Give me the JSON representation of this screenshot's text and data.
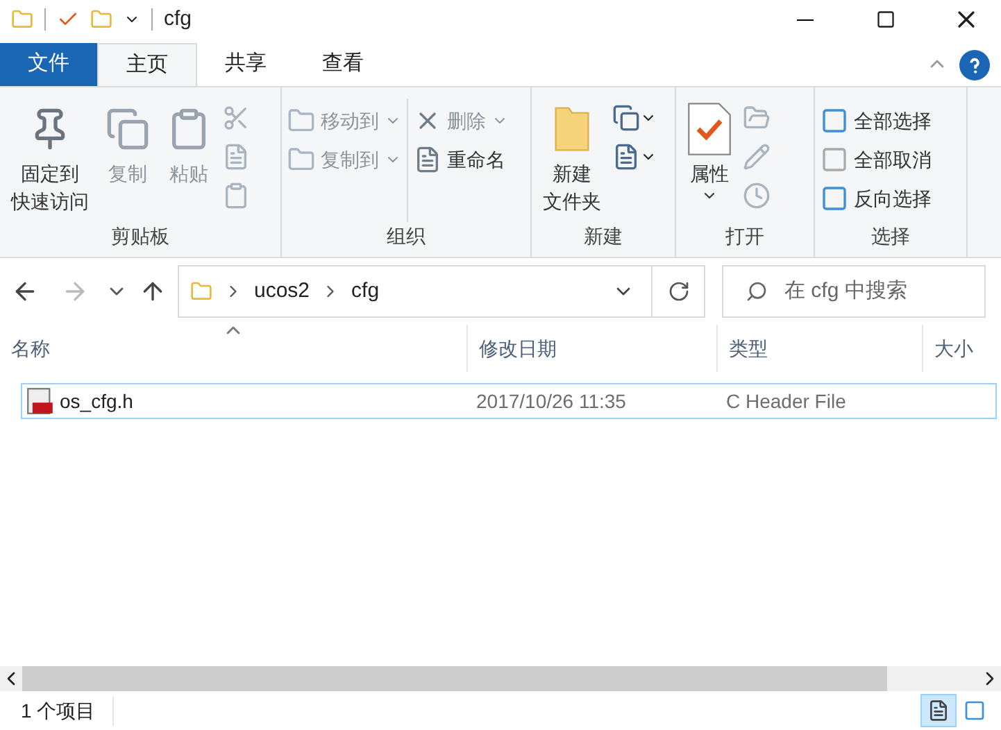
{
  "title_bar": {
    "title": "cfg"
  },
  "ribbon_tabs": [
    {
      "label": "文件",
      "kind": "file",
      "selected": false
    },
    {
      "label": "主页",
      "kind": "tab",
      "selected": true
    },
    {
      "label": "共享",
      "kind": "tab",
      "selected": false
    },
    {
      "label": "查看",
      "kind": "tab",
      "selected": false
    }
  ],
  "ribbon_groups": [
    {
      "label": "剪贴板",
      "items": [
        {
          "kind": "large",
          "lines": [
            "固定到",
            "快速访问"
          ],
          "disabled": false
        },
        {
          "kind": "large",
          "lines": [
            "复制"
          ],
          "disabled": true
        },
        {
          "kind": "large",
          "lines": [
            "粘贴"
          ],
          "disabled": true
        },
        {
          "kind": "iconstack",
          "disabled": true
        }
      ]
    },
    {
      "label": "组织",
      "items": [
        {
          "kind": "smallcol",
          "entries": [
            {
              "label": "移动到",
              "dropdown": true,
              "disabled": true
            },
            {
              "label": "复制到",
              "dropdown": true,
              "disabled": true
            }
          ]
        },
        {
          "kind": "smallcol",
          "entries": [
            {
              "label": "删除",
              "dropdown": true,
              "disabled": true
            },
            {
              "label": "重命名",
              "dropdown": false,
              "disabled": false
            }
          ]
        }
      ]
    },
    {
      "label": "新建",
      "items": [
        {
          "kind": "large",
          "lines": [
            "新建",
            "文件夹"
          ],
          "disabled": false
        },
        {
          "kind": "iconstack",
          "disabled": false
        }
      ]
    },
    {
      "label": "打开",
      "items": [
        {
          "kind": "large",
          "lines": [
            "属性"
          ],
          "dropdown": true,
          "disabled": false
        },
        {
          "kind": "iconstack",
          "disabled": true
        }
      ]
    },
    {
      "label": "选择",
      "items": [
        {
          "kind": "smallcol",
          "entries": [
            {
              "label": "全部选择",
              "dropdown": false,
              "disabled": false
            },
            {
              "label": "全部取消",
              "dropdown": false,
              "disabled": false
            },
            {
              "label": "反向选择",
              "dropdown": false,
              "disabled": false
            }
          ]
        }
      ]
    }
  ],
  "address": {
    "crumbs": [
      "ucos2",
      "cfg"
    ],
    "search_placeholder": "在 cfg 中搜索"
  },
  "columns": [
    {
      "label": "名称",
      "sorted": true
    },
    {
      "label": "修改日期",
      "sorted": false
    },
    {
      "label": "类型",
      "sorted": false
    },
    {
      "label": "大小",
      "sorted": false
    }
  ],
  "rows": [
    {
      "name": "os_cfg.h",
      "modified": "2017/10/26 11:35",
      "type": "C Header File",
      "focused": true
    }
  ],
  "status_bar": {
    "count": "1 个项目",
    "views": [
      {
        "kind": "details",
        "selected": true
      },
      {
        "kind": "icons",
        "selected": false
      }
    ]
  }
}
